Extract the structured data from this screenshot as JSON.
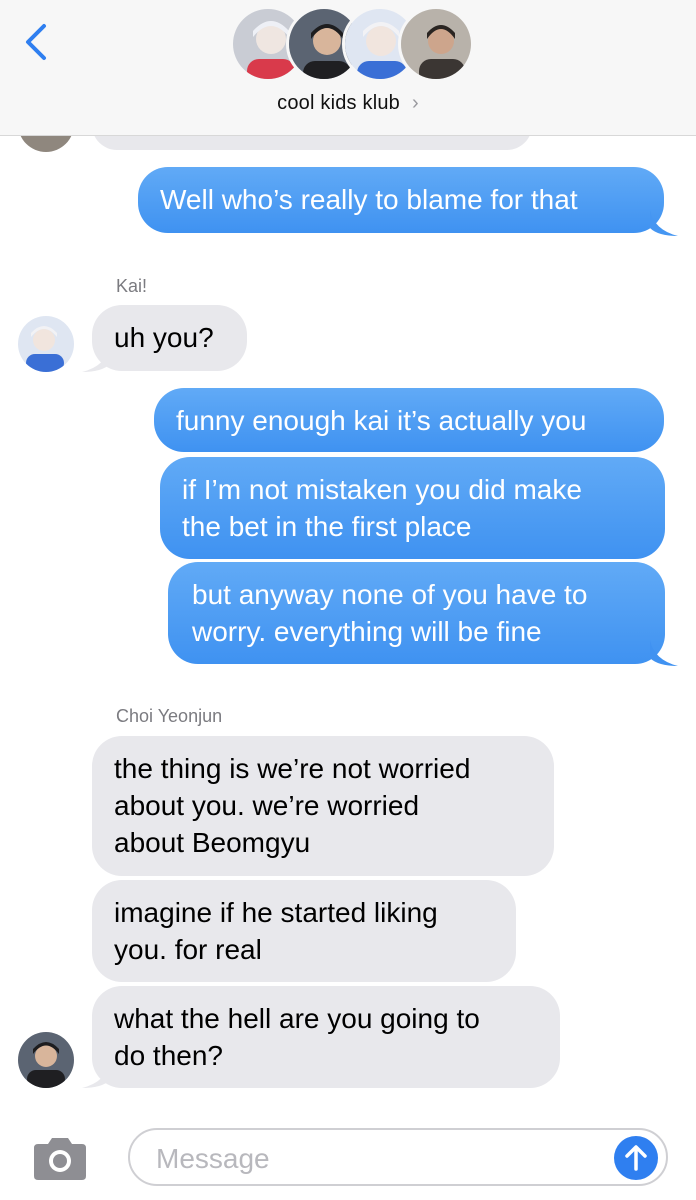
{
  "header": {
    "group_name": "cool kids klub",
    "chevron": "›",
    "avatars": [
      "avatar-1",
      "avatar-2",
      "avatar-3",
      "avatar-4"
    ]
  },
  "messages": [
    {
      "direction": "sent",
      "text": "Well who’s really to blame for that"
    },
    {
      "direction": "received",
      "sender": "Kai!",
      "text": "uh you?"
    },
    {
      "direction": "sent",
      "text": "funny enough kai it’s actually you"
    },
    {
      "direction": "sent",
      "lines": [
        "if I’m not mistaken you did make",
        "the bet in the first place"
      ]
    },
    {
      "direction": "sent",
      "lines": [
        "but anyway none of you have to",
        "worry. everything will be fine"
      ]
    },
    {
      "direction": "received",
      "sender": "Choi Yeonjun",
      "lines": [
        "the thing is we’re not worried",
        "about you. we’re worried",
        "about Beomgyu"
      ]
    },
    {
      "direction": "received",
      "lines": [
        "imagine if he started liking",
        "you. for real"
      ]
    },
    {
      "direction": "received",
      "lines": [
        "what the hell are you going to",
        "do then?"
      ]
    }
  ],
  "input": {
    "placeholder": "Message"
  },
  "colors": {
    "sent_bubble": "#4a9bf3",
    "received_bubble": "#e8e8ec",
    "accent": "#2f7ff0",
    "header_bg": "#f7f7f7"
  }
}
